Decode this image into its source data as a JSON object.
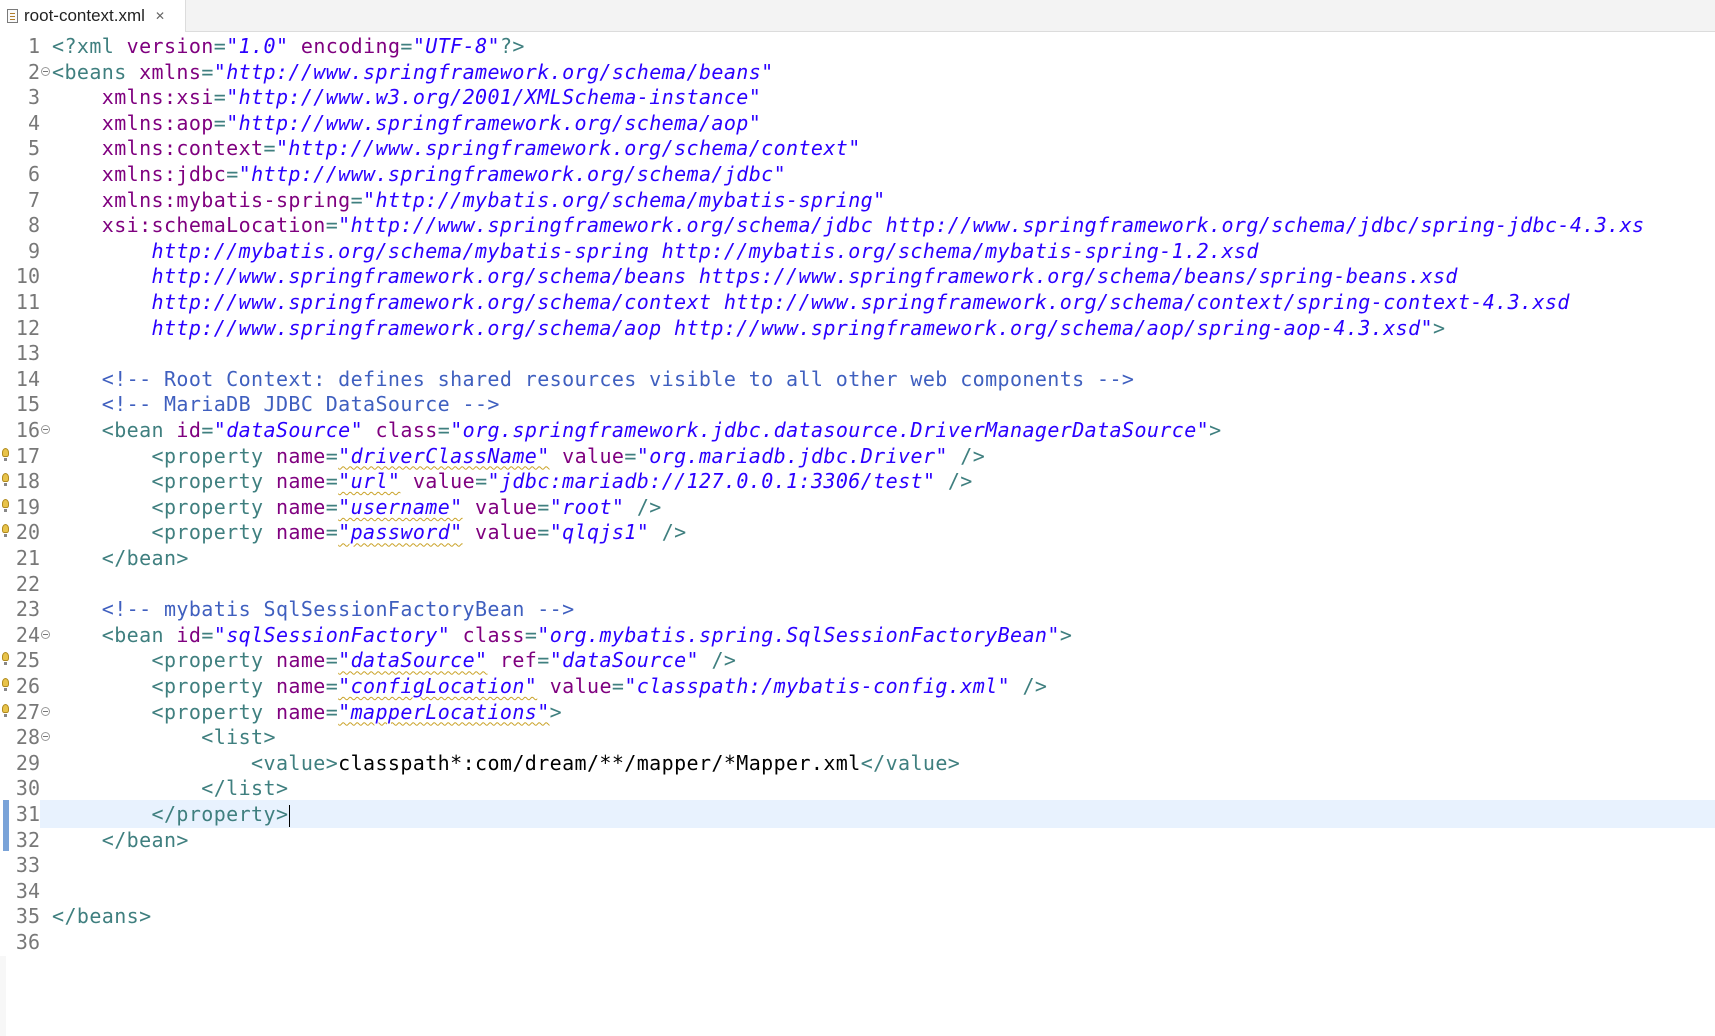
{
  "tab": {
    "title": "root-context.xml",
    "close_glyph": "✕"
  },
  "editor": {
    "lines": [
      {
        "n": "1",
        "code": [
          [
            "t",
            "<?xml "
          ],
          [
            "a",
            "version"
          ],
          [
            "t",
            "="
          ],
          [
            "v",
            "\"1.0\""
          ],
          [
            "t",
            " "
          ],
          [
            "a",
            "encoding"
          ],
          [
            "t",
            "="
          ],
          [
            "v",
            "\"UTF-8\""
          ],
          [
            "t",
            "?>"
          ]
        ]
      },
      {
        "n": "2",
        "fold": true,
        "code": [
          [
            "t",
            "<beans "
          ],
          [
            "a",
            "xmlns"
          ],
          [
            "t",
            "="
          ],
          [
            "v",
            "\"http://www.springframework.org/schema/beans\""
          ]
        ]
      },
      {
        "n": "3",
        "code": [
          [
            "t",
            "    "
          ],
          [
            "a",
            "xmlns:xsi"
          ],
          [
            "t",
            "="
          ],
          [
            "v",
            "\"http://www.w3.org/2001/XMLSchema-instance\""
          ]
        ]
      },
      {
        "n": "4",
        "code": [
          [
            "t",
            "    "
          ],
          [
            "a",
            "xmlns:aop"
          ],
          [
            "t",
            "="
          ],
          [
            "v",
            "\"http://www.springframework.org/schema/aop\""
          ]
        ]
      },
      {
        "n": "5",
        "code": [
          [
            "t",
            "    "
          ],
          [
            "a",
            "xmlns:context"
          ],
          [
            "t",
            "="
          ],
          [
            "v",
            "\"http://www.springframework.org/schema/context\""
          ]
        ]
      },
      {
        "n": "6",
        "code": [
          [
            "t",
            "    "
          ],
          [
            "a",
            "xmlns:jdbc"
          ],
          [
            "t",
            "="
          ],
          [
            "v",
            "\"http://www.springframework.org/schema/jdbc\""
          ]
        ]
      },
      {
        "n": "7",
        "code": [
          [
            "t",
            "    "
          ],
          [
            "a",
            "xmlns:mybatis-spring"
          ],
          [
            "t",
            "="
          ],
          [
            "v",
            "\"http://mybatis.org/schema/mybatis-spring\""
          ]
        ]
      },
      {
        "n": "8",
        "code": [
          [
            "t",
            "    "
          ],
          [
            "a",
            "xsi:schemaLocation"
          ],
          [
            "t",
            "="
          ],
          [
            "v",
            "\"http://www.springframework.org/schema/jdbc http://www.springframework.org/schema/jdbc/spring-jdbc-4.3.xs"
          ]
        ]
      },
      {
        "n": "9",
        "code": [
          [
            "v",
            "        http://mybatis.org/schema/mybatis-spring http://mybatis.org/schema/mybatis-spring-1.2.xsd"
          ]
        ]
      },
      {
        "n": "10",
        "code": [
          [
            "v",
            "        http://www.springframework.org/schema/beans https://www.springframework.org/schema/beans/spring-beans.xsd"
          ]
        ]
      },
      {
        "n": "11",
        "code": [
          [
            "v",
            "        http://www.springframework.org/schema/context http://www.springframework.org/schema/context/spring-context-4.3.xsd"
          ]
        ]
      },
      {
        "n": "12",
        "code": [
          [
            "v",
            "        http://www.springframework.org/schema/aop http://www.springframework.org/schema/aop/spring-aop-4.3.xsd\""
          ],
          [
            "t",
            ">"
          ]
        ]
      },
      {
        "n": "13",
        "code": []
      },
      {
        "n": "14",
        "code": [
          [
            "c",
            "    <!-- Root Context: defines shared resources visible to all other web components -->"
          ]
        ]
      },
      {
        "n": "15",
        "code": [
          [
            "c",
            "    <!-- MariaDB JDBC DataSource -->"
          ]
        ]
      },
      {
        "n": "16",
        "fold": true,
        "code": [
          [
            "t",
            "    <bean "
          ],
          [
            "a",
            "id"
          ],
          [
            "t",
            "="
          ],
          [
            "v",
            "\"dataSource\""
          ],
          [
            "t",
            " "
          ],
          [
            "a",
            "class"
          ],
          [
            "t",
            "="
          ],
          [
            "v",
            "\"org.springframework.jdbc.datasource.DriverManagerDataSource\""
          ],
          [
            "t",
            ">"
          ]
        ]
      },
      {
        "n": "17",
        "marker": true,
        "code": [
          [
            "t",
            "        <property "
          ],
          [
            "a",
            "name"
          ],
          [
            "t",
            "="
          ],
          [
            "vs",
            "\"driverClassName\""
          ],
          [
            "t",
            " "
          ],
          [
            "a",
            "value"
          ],
          [
            "t",
            "="
          ],
          [
            "v",
            "\"org.mariadb.jdbc.Driver\""
          ],
          [
            "t",
            " />"
          ]
        ]
      },
      {
        "n": "18",
        "marker": true,
        "code": [
          [
            "t",
            "        <property "
          ],
          [
            "a",
            "name"
          ],
          [
            "t",
            "="
          ],
          [
            "vs",
            "\"url\""
          ],
          [
            "t",
            " "
          ],
          [
            "a",
            "value"
          ],
          [
            "t",
            "="
          ],
          [
            "v",
            "\"jdbc:mariadb://127.0.0.1:3306/test\""
          ],
          [
            "t",
            " />"
          ]
        ]
      },
      {
        "n": "19",
        "marker": true,
        "code": [
          [
            "t",
            "        <property "
          ],
          [
            "a",
            "name"
          ],
          [
            "t",
            "="
          ],
          [
            "vs",
            "\"username\""
          ],
          [
            "t",
            " "
          ],
          [
            "a",
            "value"
          ],
          [
            "t",
            "="
          ],
          [
            "v",
            "\"root\""
          ],
          [
            "t",
            " />"
          ]
        ]
      },
      {
        "n": "20",
        "marker": true,
        "code": [
          [
            "t",
            "        <property "
          ],
          [
            "a",
            "name"
          ],
          [
            "t",
            "="
          ],
          [
            "vs",
            "\"password\""
          ],
          [
            "t",
            " "
          ],
          [
            "a",
            "value"
          ],
          [
            "t",
            "="
          ],
          [
            "v",
            "\"qlqjs1\""
          ],
          [
            "t",
            " />"
          ]
        ]
      },
      {
        "n": "21",
        "code": [
          [
            "t",
            "    </bean>"
          ]
        ]
      },
      {
        "n": "22",
        "code": []
      },
      {
        "n": "23",
        "code": [
          [
            "c",
            "    <!-- mybatis SqlSessionFactoryBean -->"
          ]
        ]
      },
      {
        "n": "24",
        "fold": true,
        "code": [
          [
            "t",
            "    <bean "
          ],
          [
            "a",
            "id"
          ],
          [
            "t",
            "="
          ],
          [
            "v",
            "\"sqlSessionFactory\""
          ],
          [
            "t",
            " "
          ],
          [
            "a",
            "class"
          ],
          [
            "t",
            "="
          ],
          [
            "v",
            "\"org.mybatis.spring.SqlSessionFactoryBean\""
          ],
          [
            "t",
            ">"
          ]
        ]
      },
      {
        "n": "25",
        "marker": true,
        "code": [
          [
            "t",
            "        <property "
          ],
          [
            "a",
            "name"
          ],
          [
            "t",
            "="
          ],
          [
            "vs",
            "\"dataSource\""
          ],
          [
            "t",
            " "
          ],
          [
            "a",
            "ref"
          ],
          [
            "t",
            "="
          ],
          [
            "v",
            "\"dataSource\""
          ],
          [
            "t",
            " />"
          ]
        ]
      },
      {
        "n": "26",
        "marker": true,
        "code": [
          [
            "t",
            "        <property "
          ],
          [
            "a",
            "name"
          ],
          [
            "t",
            "="
          ],
          [
            "vs",
            "\"configLocation\""
          ],
          [
            "t",
            " "
          ],
          [
            "a",
            "value"
          ],
          [
            "t",
            "="
          ],
          [
            "v",
            "\"classpath:/mybatis-config.xml\""
          ],
          [
            "t",
            " />"
          ]
        ]
      },
      {
        "n": "27",
        "marker": true,
        "fold": true,
        "code": [
          [
            "t",
            "        <property "
          ],
          [
            "a",
            "name"
          ],
          [
            "t",
            "="
          ],
          [
            "vs",
            "\"mapperLocations\""
          ],
          [
            "t",
            ">"
          ]
        ]
      },
      {
        "n": "28",
        "fold": true,
        "code": [
          [
            "t",
            "            <list>"
          ]
        ]
      },
      {
        "n": "29",
        "code": [
          [
            "t",
            "                <value>"
          ],
          [
            "x",
            "classpath*:com/dream/**/mapper/*Mapper.xml"
          ],
          [
            "t",
            "</value>"
          ]
        ]
      },
      {
        "n": "30",
        "code": [
          [
            "t",
            "            </list>"
          ]
        ]
      },
      {
        "n": "31",
        "current": true,
        "changed": true,
        "caret": true,
        "code": [
          [
            "t",
            "        </property>"
          ]
        ]
      },
      {
        "n": "32",
        "changed": true,
        "code": [
          [
            "t",
            "    </bean>"
          ]
        ]
      },
      {
        "n": "33",
        "code": []
      },
      {
        "n": "34",
        "code": []
      },
      {
        "n": "35",
        "code": [
          [
            "t",
            "</beans>"
          ]
        ]
      },
      {
        "n": "36",
        "code": []
      }
    ]
  }
}
